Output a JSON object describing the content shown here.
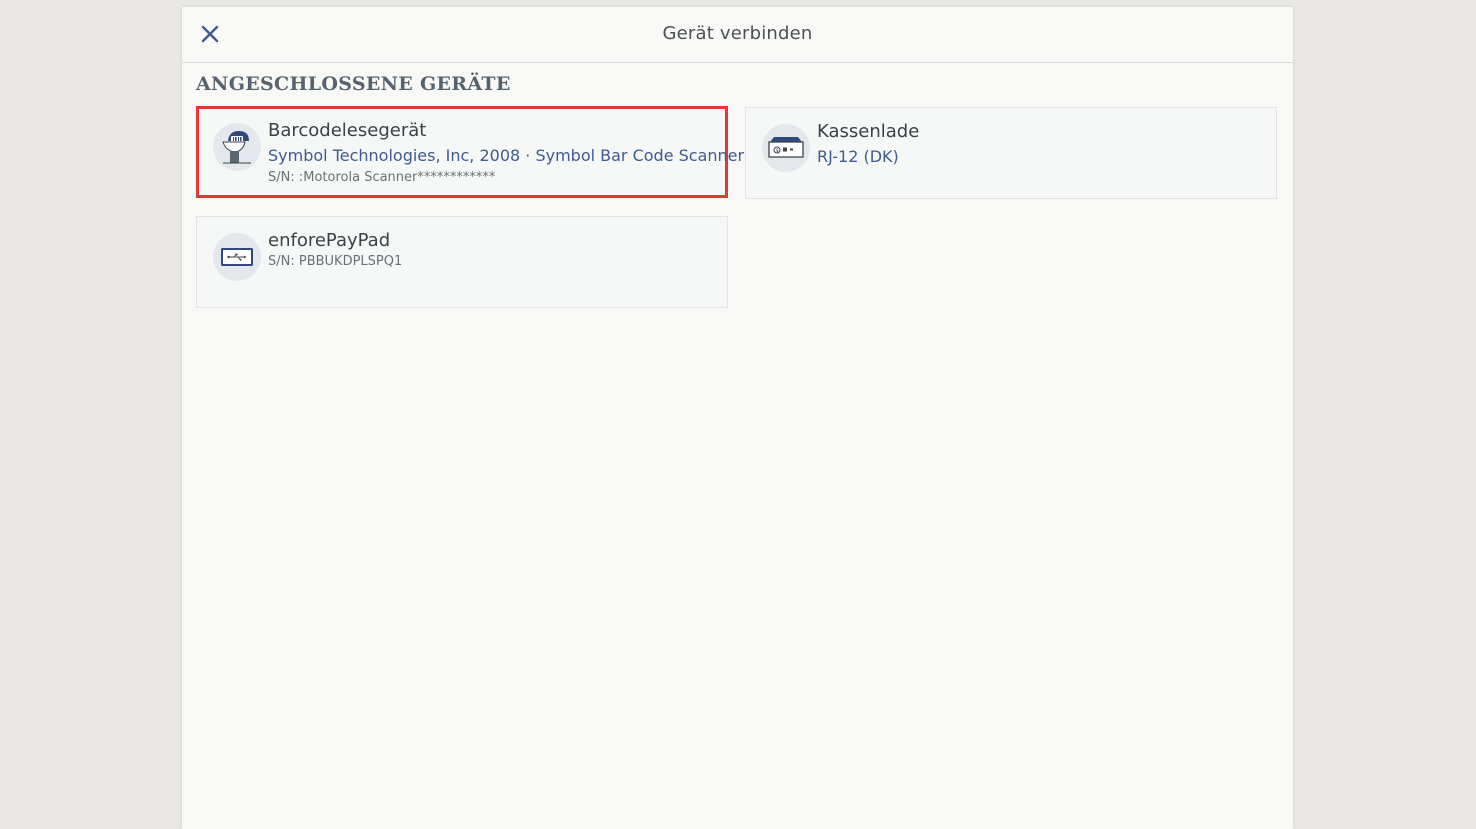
{
  "dialog": {
    "title": "Gerät verbinden",
    "close_icon": "close-icon"
  },
  "section": {
    "heading": "ANGESCHLOSSENE GERÄTE"
  },
  "devices": [
    {
      "title": "Barcodelesegerät",
      "subtitle": "Symbol Technologies, Inc, 2008 · Symbol Bar Code Scanner",
      "serial": "S/N: :Motorola Scanner************",
      "icon": "barcode-scanner-icon",
      "selected": true
    },
    {
      "title": "Kassenlade",
      "subtitle": "RJ-12 (DK)",
      "serial": "",
      "icon": "cash-drawer-icon",
      "selected": false
    },
    {
      "title": "enforePayPad",
      "subtitle": "",
      "serial": "S/N: PBBUKDPLSPQ1",
      "icon": "payment-terminal-icon",
      "selected": false
    }
  ],
  "colors": {
    "accent": "#3f5a8e",
    "selection": "#e53935",
    "background": "#e9e7e3",
    "panel": "#f8f8f7"
  }
}
